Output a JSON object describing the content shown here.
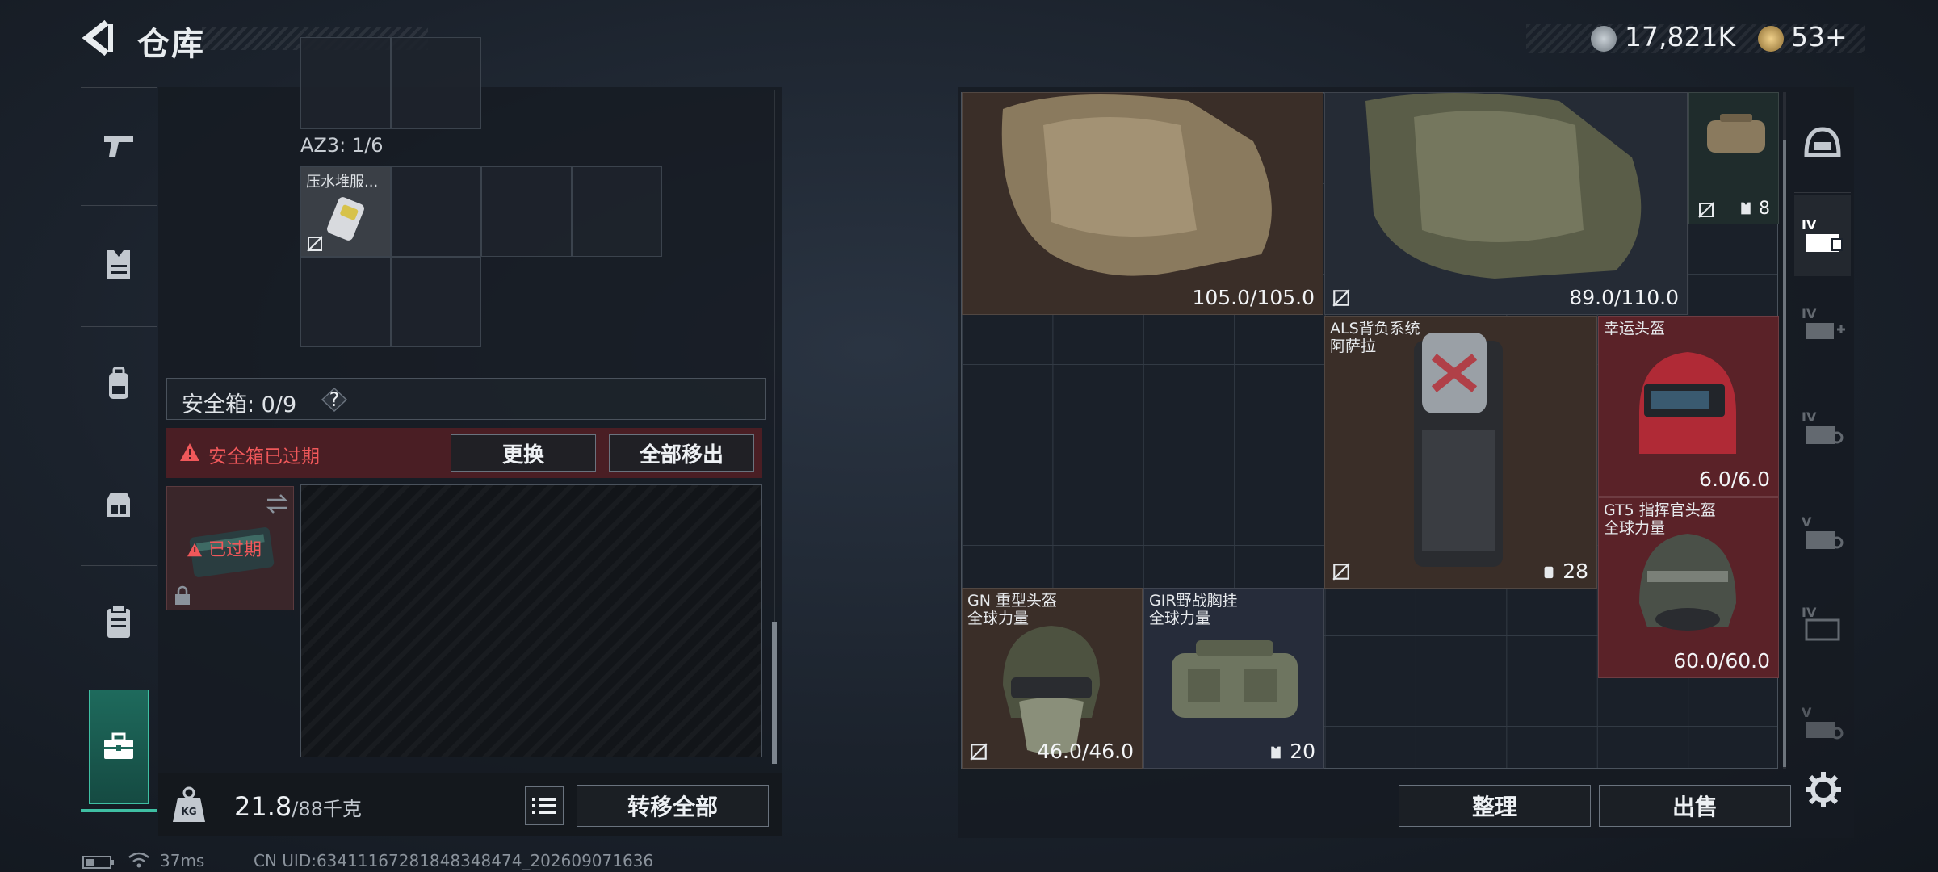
{
  "header": {
    "title": "仓库",
    "currency1": "17,821K",
    "currency2": "53+",
    "colors": {
      "coin1": "#9aa4ae",
      "coin2": "#c9a35a"
    }
  },
  "left_nav": {
    "items": [
      {
        "icon": "pistol-icon"
      },
      {
        "icon": "armor-vest-icon"
      },
      {
        "icon": "backpack-icon"
      },
      {
        "icon": "chest-rig-icon"
      },
      {
        "icon": "clipboard-icon"
      },
      {
        "icon": "toolbox-icon",
        "active": true
      }
    ]
  },
  "left_panel": {
    "az_label": "AZ3: 1/6",
    "az_item_label": "压水堆服...",
    "safe_box_label": "安全箱: 0/9",
    "help_label": "?",
    "expired_warning": "安全箱已过期",
    "replace_button": "更换",
    "remove_all_button": "全部移出",
    "expired_badge": "已过期",
    "weight_current": "21.8",
    "weight_max": "/88千克",
    "weight_icon_label": "KG",
    "transfer_all_button": "转移全部"
  },
  "status_bar": {
    "ping": "37ms",
    "uid": "CN UID:63411167281848348474_202609071636"
  },
  "inventory": {
    "items": [
      {
        "name": "",
        "value": "105.0/105.0",
        "color": "#3a2e28"
      },
      {
        "name": "",
        "value": "89.0/110.0",
        "color": "#252b35"
      },
      {
        "name": "",
        "value": "8",
        "color": "#1f2c2c"
      },
      {
        "name": "ALS背负系统\n阿萨拉",
        "value": "28",
        "color": "#3a2e28"
      },
      {
        "name": "幸运头盔",
        "value": "6.0/6.0",
        "color": "#5a2228"
      },
      {
        "name": "GT5 指挥官头盔\n全球力量",
        "value": "60.0/60.0",
        "color": "#5a2228"
      },
      {
        "name": "GN 重型头盔\n全球力量",
        "value": "46.0/46.0",
        "color": "#3a2e28"
      },
      {
        "name": "GIR野战胸挂\n全球力量",
        "value": "20",
        "color": "#262c3a"
      }
    ],
    "sort_button": "整理",
    "sell_button": "出售"
  },
  "right_nav": {
    "items": [
      "helmet-icon",
      "tier-iv-armor-icon",
      "tier-iv-add-icon",
      "tier-iv-rig-icon",
      "tier-v-rig-icon",
      "tier-iv-bag-icon",
      "tier-v-item-icon"
    ]
  }
}
